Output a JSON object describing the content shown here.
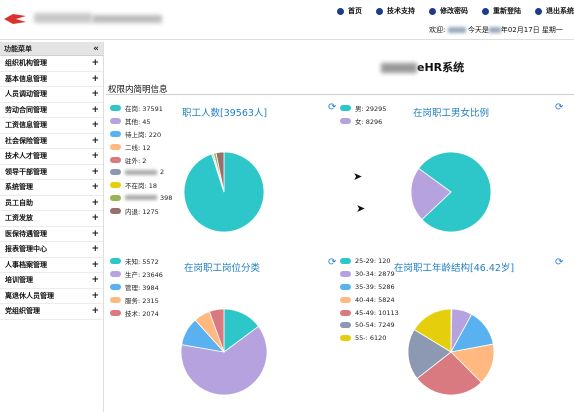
{
  "header": {
    "nav": [
      {
        "label": "首页",
        "icon": "home-icon"
      },
      {
        "label": "技术支持",
        "icon": "support-icon"
      },
      {
        "label": "修改密码",
        "icon": "password-icon"
      },
      {
        "label": "重新登陆",
        "icon": "relogin-icon"
      },
      {
        "label": "退出系统",
        "icon": "logout-icon"
      }
    ],
    "welcome_prefix": "欢迎:",
    "welcome_suffix": "今天是",
    "welcome_date": "年02月17日 星期一",
    "brand_color": "#d9342b"
  },
  "sidebar": {
    "title": "功能菜单",
    "collapse": "«",
    "items": [
      "组织机构管理",
      "基本信息管理",
      "人员调动管理",
      "劳动合同管理",
      "工资信息管理",
      "社会保险管理",
      "技术人才管理",
      "领导干部管理",
      "系统管理",
      "员工自助",
      "工资发放",
      "医保待遇管理",
      "报表管理中心",
      "人事档案管理",
      "培训管理",
      "离退休人员管理",
      "党组织管理"
    ]
  },
  "main": {
    "system_title": "eHR系统",
    "panel_title": "权限内简明信息"
  },
  "chart_data": [
    {
      "type": "pie",
      "title": "职工人数[39563人]",
      "series": [
        {
          "label": "在岗",
          "display": "在岗: 37591",
          "value": 37591,
          "color": "#2ec7c9"
        },
        {
          "label": "其他",
          "display": "其他: 45",
          "value": 45,
          "color": "#b6a2de"
        },
        {
          "label": "待上岗",
          "display": "待上岗: 220",
          "value": 220,
          "color": "#5ab1ef"
        },
        {
          "label": "二线",
          "display": "二线: 12",
          "value": 12,
          "color": "#ffb980"
        },
        {
          "label": "驻外",
          "display": "驻外: 2",
          "value": 2,
          "color": "#d87a80"
        },
        {
          "label": "",
          "display": " 2",
          "value": 2,
          "color": "#8d98b3",
          "blurred": true
        },
        {
          "label": "不在岗",
          "display": "不在岗: 18",
          "value": 18,
          "color": "#e5cf0d"
        },
        {
          "label": "",
          "display": " 398",
          "value": 398,
          "color": "#97b552",
          "blurred": true
        },
        {
          "label": "内退",
          "display": "内退: 1275",
          "value": 1275,
          "color": "#95706d"
        }
      ]
    },
    {
      "type": "pie",
      "title": "在岗职工男女比例",
      "series": [
        {
          "label": "男",
          "display": "男: 29295",
          "value": 29295,
          "color": "#2ec7c9"
        },
        {
          "label": "女",
          "display": "女: 8296",
          "value": 8296,
          "color": "#b6a2de"
        }
      ]
    },
    {
      "type": "pie",
      "title": "在岗职工岗位分类",
      "series": [
        {
          "label": "未知",
          "display": "未知: 5572",
          "value": 5572,
          "color": "#2ec7c9"
        },
        {
          "label": "生产",
          "display": "生产: 23646",
          "value": 23646,
          "color": "#b6a2de"
        },
        {
          "label": "管理",
          "display": "管理: 3984",
          "value": 3984,
          "color": "#5ab1ef"
        },
        {
          "label": "服务",
          "display": "服务: 2315",
          "value": 2315,
          "color": "#ffb980"
        },
        {
          "label": "技术",
          "display": "技术: 2074",
          "value": 2074,
          "color": "#d87a80"
        }
      ]
    },
    {
      "type": "pie",
      "title": "在岗职工年龄结构[46.42岁]",
      "series": [
        {
          "label": "25-29",
          "display": "25-29: 120",
          "value": 120,
          "color": "#2ec7c9"
        },
        {
          "label": "30-34",
          "display": "30-34: 2879",
          "value": 2879,
          "color": "#b6a2de"
        },
        {
          "label": "35-39",
          "display": "35-39: 5286",
          "value": 5286,
          "color": "#5ab1ef"
        },
        {
          "label": "40-44",
          "display": "40-44: 5824",
          "value": 5824,
          "color": "#ffb980"
        },
        {
          "label": "45-49",
          "display": "45-49: 10113",
          "value": 10113,
          "color": "#d87a80"
        },
        {
          "label": "50-54",
          "display": "50-54: 7249",
          "value": 7249,
          "color": "#8d98b3"
        },
        {
          "label": "55-",
          "display": "55-: 6120",
          "value": 6120,
          "color": "#e5cf0d"
        }
      ]
    }
  ]
}
